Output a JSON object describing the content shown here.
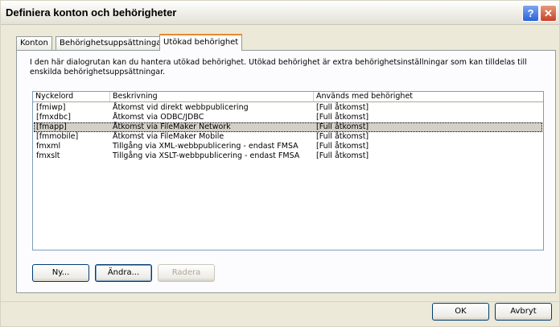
{
  "window": {
    "title": "Definiera konton och behörigheter",
    "help_label": "?",
    "close_label": "✕"
  },
  "tabs": [
    {
      "label": "Konton",
      "selected": false
    },
    {
      "label": "Behörighetsuppsättningar",
      "selected": false
    },
    {
      "label": "Utökad behörighet",
      "selected": true
    }
  ],
  "description": "I den här dialogrutan kan du hantera utökad behörighet. Utökad behörighet är extra behörighetsinställningar som kan tilldelas till enskilda behörighetsuppsättningar.",
  "table": {
    "columns": [
      "Nyckelord",
      "Beskrivning",
      "Används med behörighet"
    ],
    "rows": [
      {
        "keyword": "[fmiwp]",
        "description": "Åtkomst vid direkt webbpublicering",
        "used_with": "[Full åtkomst]",
        "selected": false
      },
      {
        "keyword": "[fmxdbc]",
        "description": "Åtkomst via ODBC/JDBC",
        "used_with": "[Full åtkomst]",
        "selected": false
      },
      {
        "keyword": "[fmapp]",
        "description": "Åtkomst via FileMaker Network",
        "used_with": "[Full åtkomst]",
        "selected": true
      },
      {
        "keyword": "[fmmobile]",
        "description": "Åtkomst via FileMaker Mobile",
        "used_with": "[Full åtkomst]",
        "selected": false
      },
      {
        "keyword": "fmxml",
        "description": "Tillgång via XML-webbpublicering - endast FMSA",
        "used_with": "[Full åtkomst]",
        "selected": false
      },
      {
        "keyword": "fmxslt",
        "description": "Tillgång via XSLT-webbpublicering - endast FMSA",
        "used_with": "[Full åtkomst]",
        "selected": false
      }
    ]
  },
  "buttons": {
    "new_label": "Ny...",
    "edit_label": "Ändra...",
    "delete_label": "Radera",
    "ok_label": "OK",
    "cancel_label": "Avbryt"
  }
}
